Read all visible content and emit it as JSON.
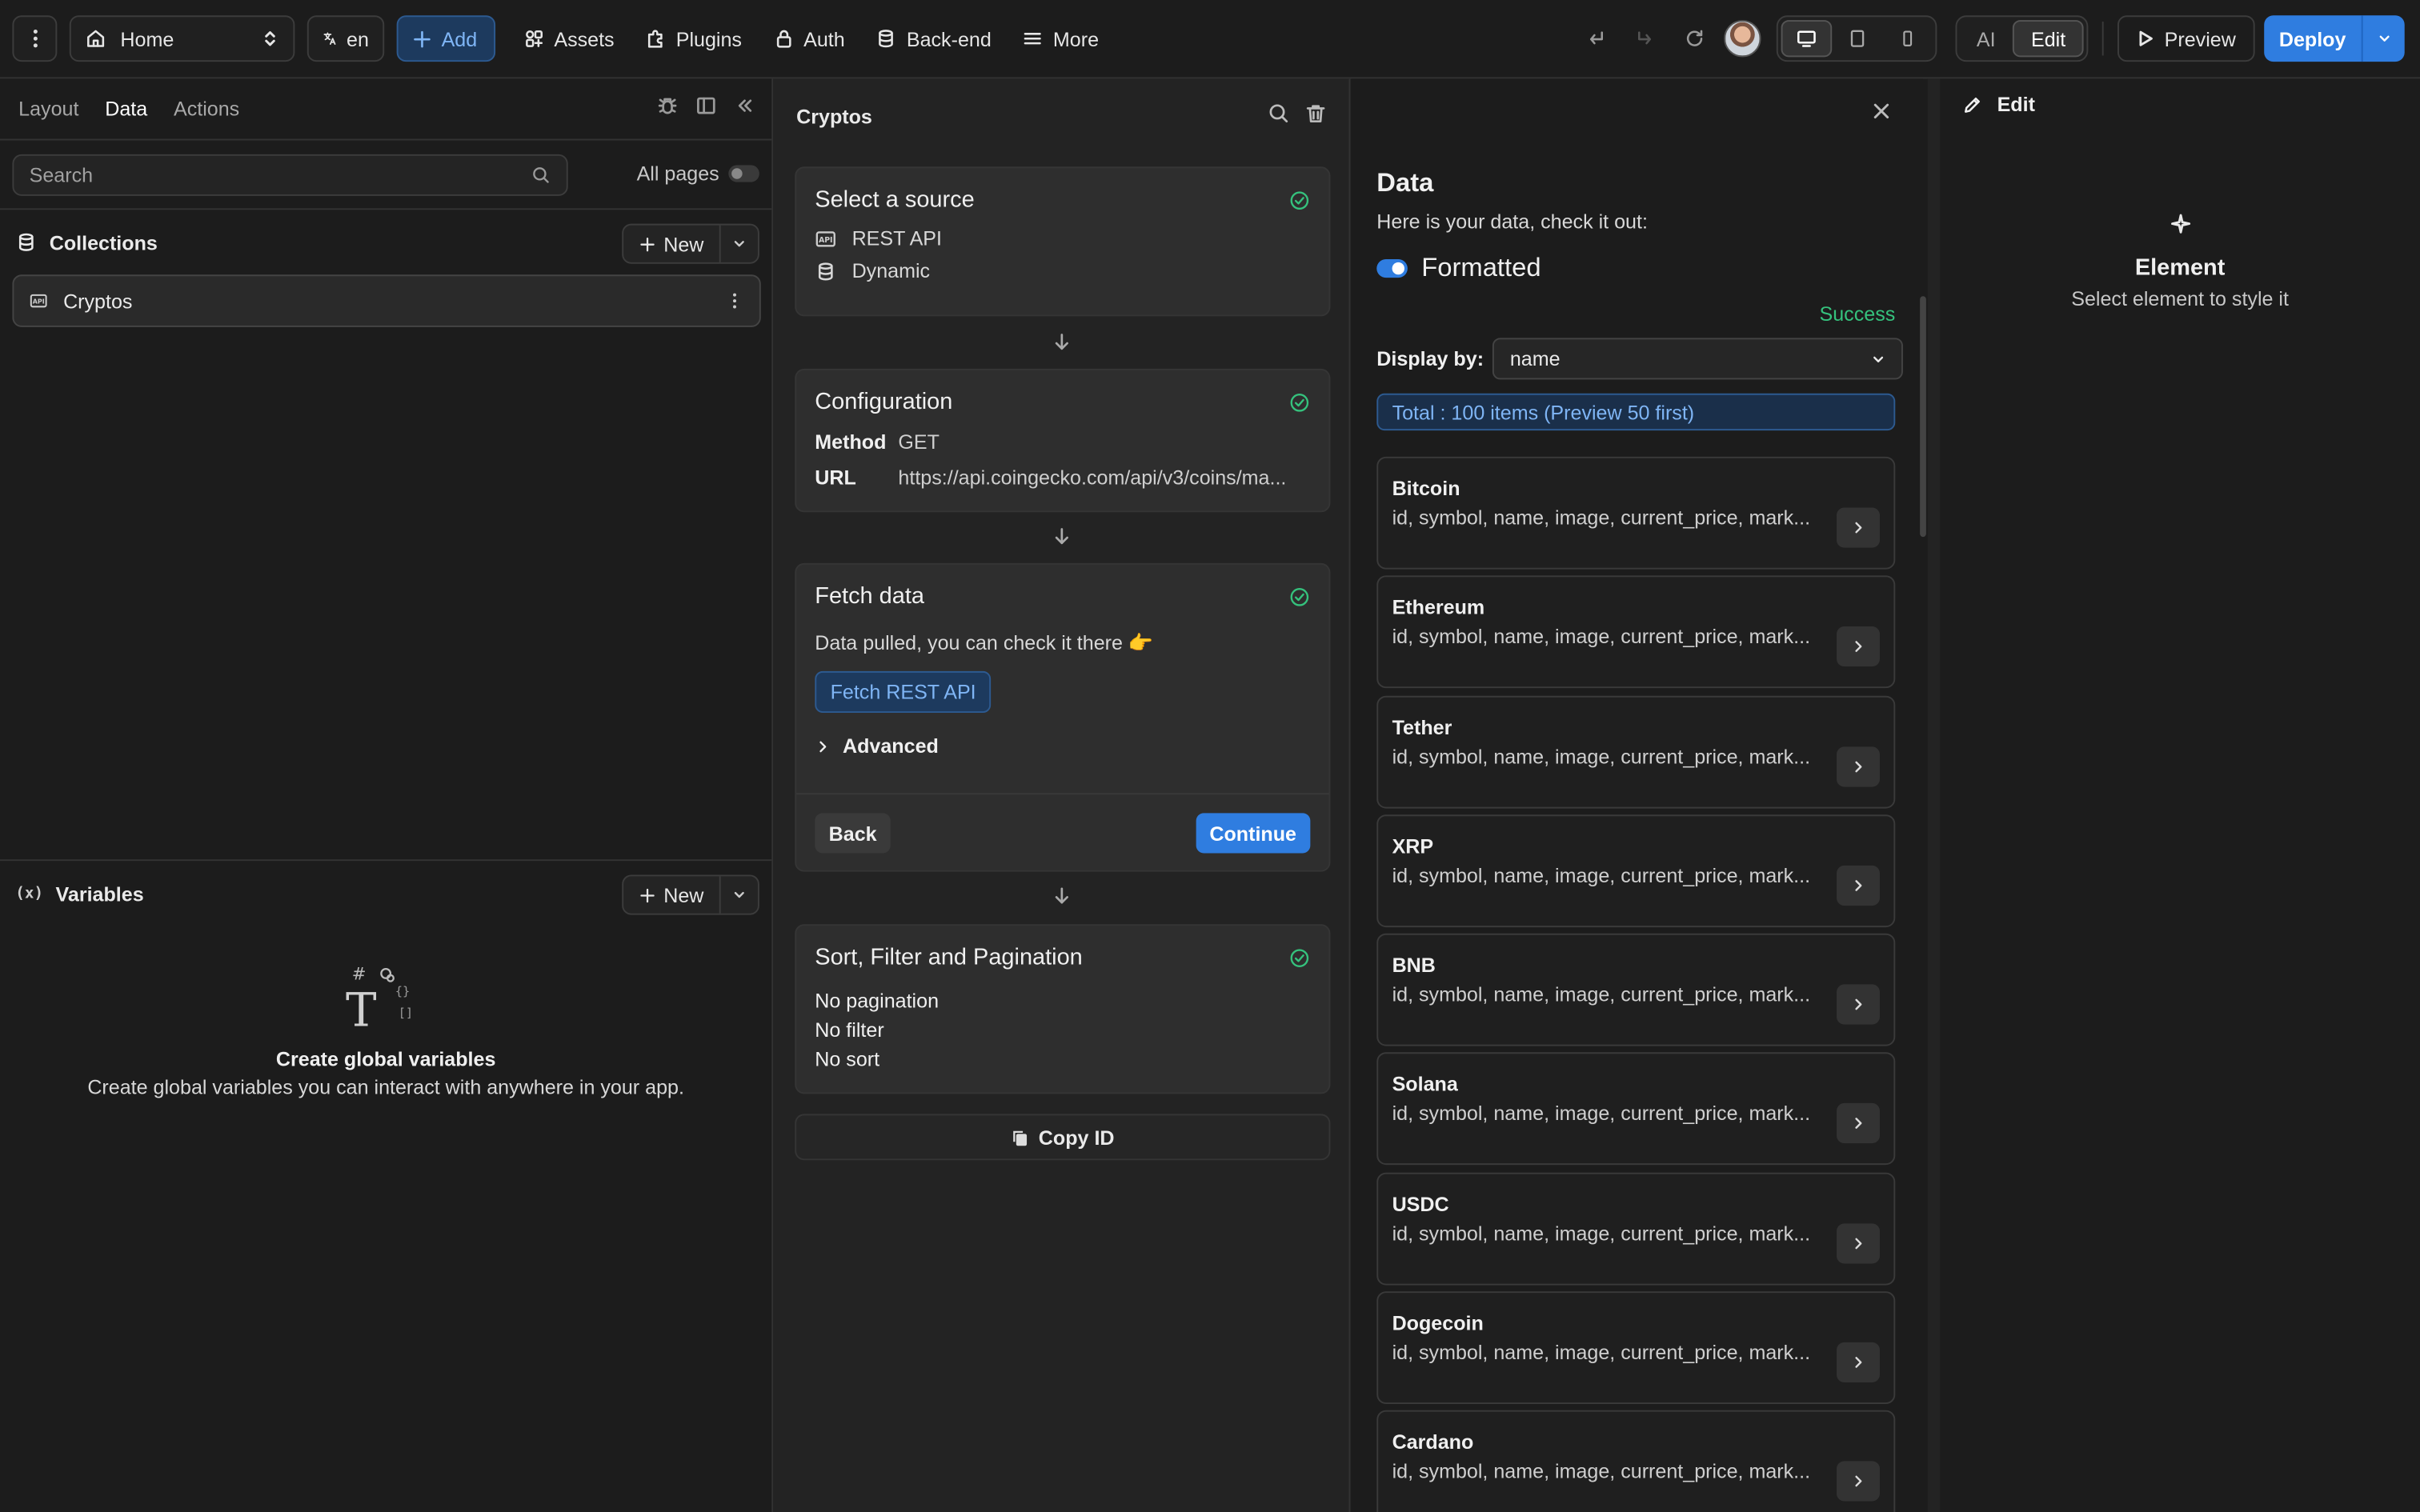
{
  "topbar": {
    "page": "Home",
    "lang": "en",
    "add": "Add",
    "nav": [
      "Assets",
      "Plugins",
      "Auth",
      "Back-end",
      "More"
    ],
    "mode": {
      "ai": "AI",
      "edit": "Edit"
    },
    "preview": "Preview",
    "deploy": "Deploy"
  },
  "left": {
    "tabs": [
      "Layout",
      "Data",
      "Actions"
    ],
    "active_tab": "Data",
    "search_placeholder": "Search",
    "all_pages": "All pages",
    "collections": {
      "title": "Collections",
      "new": "New",
      "items": [
        "Cryptos"
      ]
    },
    "variables": {
      "title": "Variables",
      "new": "New",
      "empty_title": "Create global variables",
      "empty_desc": "Create global variables you can interact with anywhere in your app."
    }
  },
  "middle": {
    "title": "Cryptos",
    "source": {
      "heading": "Select a source",
      "type": "REST API",
      "mode": "Dynamic"
    },
    "config": {
      "heading": "Configuration",
      "method_label": "Method",
      "method": "GET",
      "url_label": "URL",
      "url": "https://api.coingecko.com/api/v3/coins/ma..."
    },
    "fetch": {
      "heading": "Fetch data",
      "desc": "Data pulled, you can check it there 👉",
      "button": "Fetch REST API",
      "advanced": "Advanced",
      "back": "Back",
      "continue": "Continue"
    },
    "sfp": {
      "heading": "Sort, Filter and Pagination",
      "lines": [
        "No pagination",
        "No filter",
        "No sort"
      ]
    },
    "copy_id": "Copy ID"
  },
  "data_panel": {
    "title": "Data",
    "subtitle": "Here is your data, check it out:",
    "formatted": "Formatted",
    "status": "Success",
    "display_by_label": "Display by:",
    "display_by_value": "name",
    "total": "Total : 100 items (Preview 50 first)",
    "fields_preview": "id, symbol, name, image, current_price, mark...",
    "items": [
      "Bitcoin",
      "Ethereum",
      "Tether",
      "XRP",
      "BNB",
      "Solana",
      "USDC",
      "Dogecoin",
      "Cardano"
    ]
  },
  "right": {
    "edit": "Edit",
    "element_title": "Element",
    "element_desc": "Select element to style it"
  },
  "colors": {
    "accent": "#2f7de0",
    "success": "#35c27d",
    "background": "#1c1c1c"
  }
}
